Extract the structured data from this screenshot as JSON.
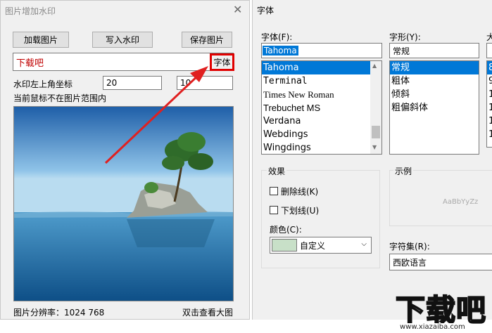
{
  "left_window": {
    "title": "图片增加水印",
    "buttons": {
      "load": "加载图片",
      "write": "写入水印",
      "save": "保存图片",
      "font": "字体"
    },
    "watermark_text": "下载吧",
    "coord_label": "水印左上角坐标",
    "x_value": "20",
    "y_value": "10",
    "status": "当前鼠标不在图片范围内",
    "resolution": "图片分辨率：1024 768",
    "dbl_click": "双击查看大图"
  },
  "font_dialog": {
    "title": "字体",
    "font_label": "字体(F):",
    "style_label": "字形(Y):",
    "size_label": "大",
    "font_value": "Tahoma",
    "style_value": "常规",
    "fonts": [
      "Tahoma",
      "Terminal",
      "Times New Roman",
      "Trebuchet MS",
      "Verdana",
      "Webdings",
      "Wingdings"
    ],
    "styles": [
      "常规",
      "粗体",
      "倾斜",
      "粗偏斜体"
    ],
    "size_value": "",
    "sizes": [
      "8",
      "9",
      "1",
      "1",
      "1",
      "1"
    ],
    "effects_label": "效果",
    "strikeout": "删除线(K)",
    "underline": "下划线(U)",
    "color_label": "颜色(C):",
    "color_value": "自定义",
    "sample_label": "示例",
    "sample_text": "AaBbYyZz",
    "charset_label": "字符集(R):",
    "charset_value": "西欧语言"
  },
  "site_watermark": {
    "big": "下载吧",
    "url": "www.xiazaiba.com"
  },
  "colors": {
    "selection": "#0078d7",
    "highlight_border": "#e00000",
    "arrow": "#e02020",
    "watermark_text": "#c00000",
    "color_swatch": "#c8e0c8"
  }
}
